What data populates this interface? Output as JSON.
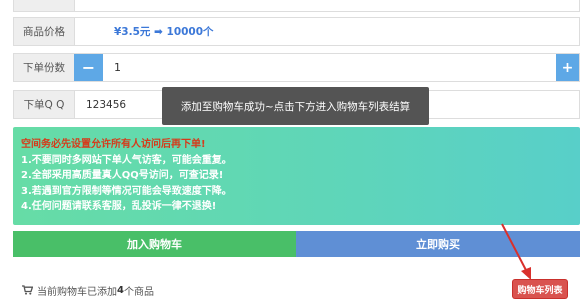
{
  "price_row": {
    "label": "商品价格",
    "value": "¥3.5元 ➡ 10000个"
  },
  "quantity_row": {
    "label": "下单份数",
    "minus": "−",
    "value": "1",
    "plus": "+"
  },
  "qq_row": {
    "label": "下单Q Q",
    "value": "123456"
  },
  "toast": {
    "message": "添加至购物车成功~点击下方进入购物车列表结算"
  },
  "notice": {
    "lines": [
      "空间务必先设置允许所有人访问后再下单!",
      "1.不要同时多网站下单人气访客，可能会重复。",
      "2.全部采用高质量真人QQ号访问，可查记录!",
      "3.若遇到官方限制等情况可能会导致速度下降。",
      "4.任何问题请联系客服，乱投诉一律不退换!"
    ]
  },
  "actions": {
    "add_to_cart": "加入购物车",
    "buy_now": "立即购买"
  },
  "cart": {
    "status_prefix": "当前购物车已添加",
    "count": "4",
    "status_suffix": "个商品",
    "list_button": "购物车列表"
  },
  "colors": {
    "accent_blue": "#5ea8e6",
    "green": "#49bf68",
    "blue_button": "#5f8fd5",
    "red": "#d9534f"
  }
}
